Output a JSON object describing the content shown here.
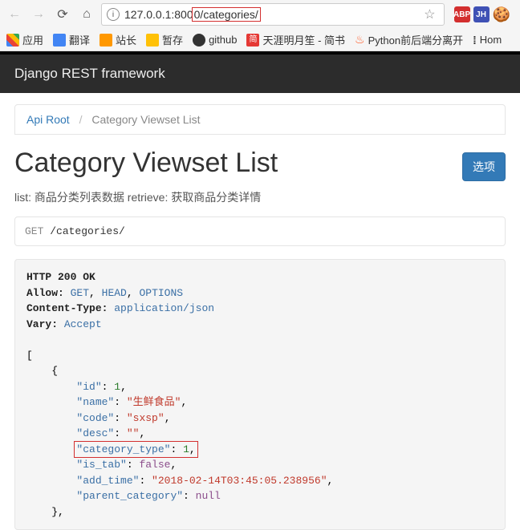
{
  "browser": {
    "url_prefix": "127.0.0.1:800",
    "url_highlight": "0/categories/",
    "bookmarks": {
      "apps": "应用",
      "translate": "翻译",
      "zhanzhang": "站长",
      "zancun": "暂存",
      "github": "github",
      "jian": "简",
      "tianya": "天涯明月笙 - 简书",
      "python": "Python前后端分离开",
      "hom": "Hom"
    },
    "ext": {
      "abp": "ABP",
      "jh": "JH"
    }
  },
  "drf_title": "Django REST framework",
  "breadcrumb": {
    "root": "Api Root",
    "current": "Category Viewset List"
  },
  "page_title": "Category Viewset List",
  "options_label": "选项",
  "desc": "list: 商品分类列表数据 retrieve: 获取商品分类详情",
  "request": {
    "method": "GET",
    "path": "/categories/"
  },
  "response": {
    "status": "HTTP 200 OK",
    "allow_label": "Allow:",
    "allow_values": [
      "GET",
      "HEAD",
      "OPTIONS"
    ],
    "ct_label": "Content-Type:",
    "ct_value": "application/json",
    "vary_label": "Vary:",
    "vary_value": "Accept",
    "item": {
      "id": 1,
      "name": "生鲜食品",
      "code": "sxsp",
      "desc": "",
      "category_type": 1,
      "is_tab": "false",
      "add_time": "2018-02-14T03:45:05.238956",
      "parent_category": "null"
    }
  }
}
